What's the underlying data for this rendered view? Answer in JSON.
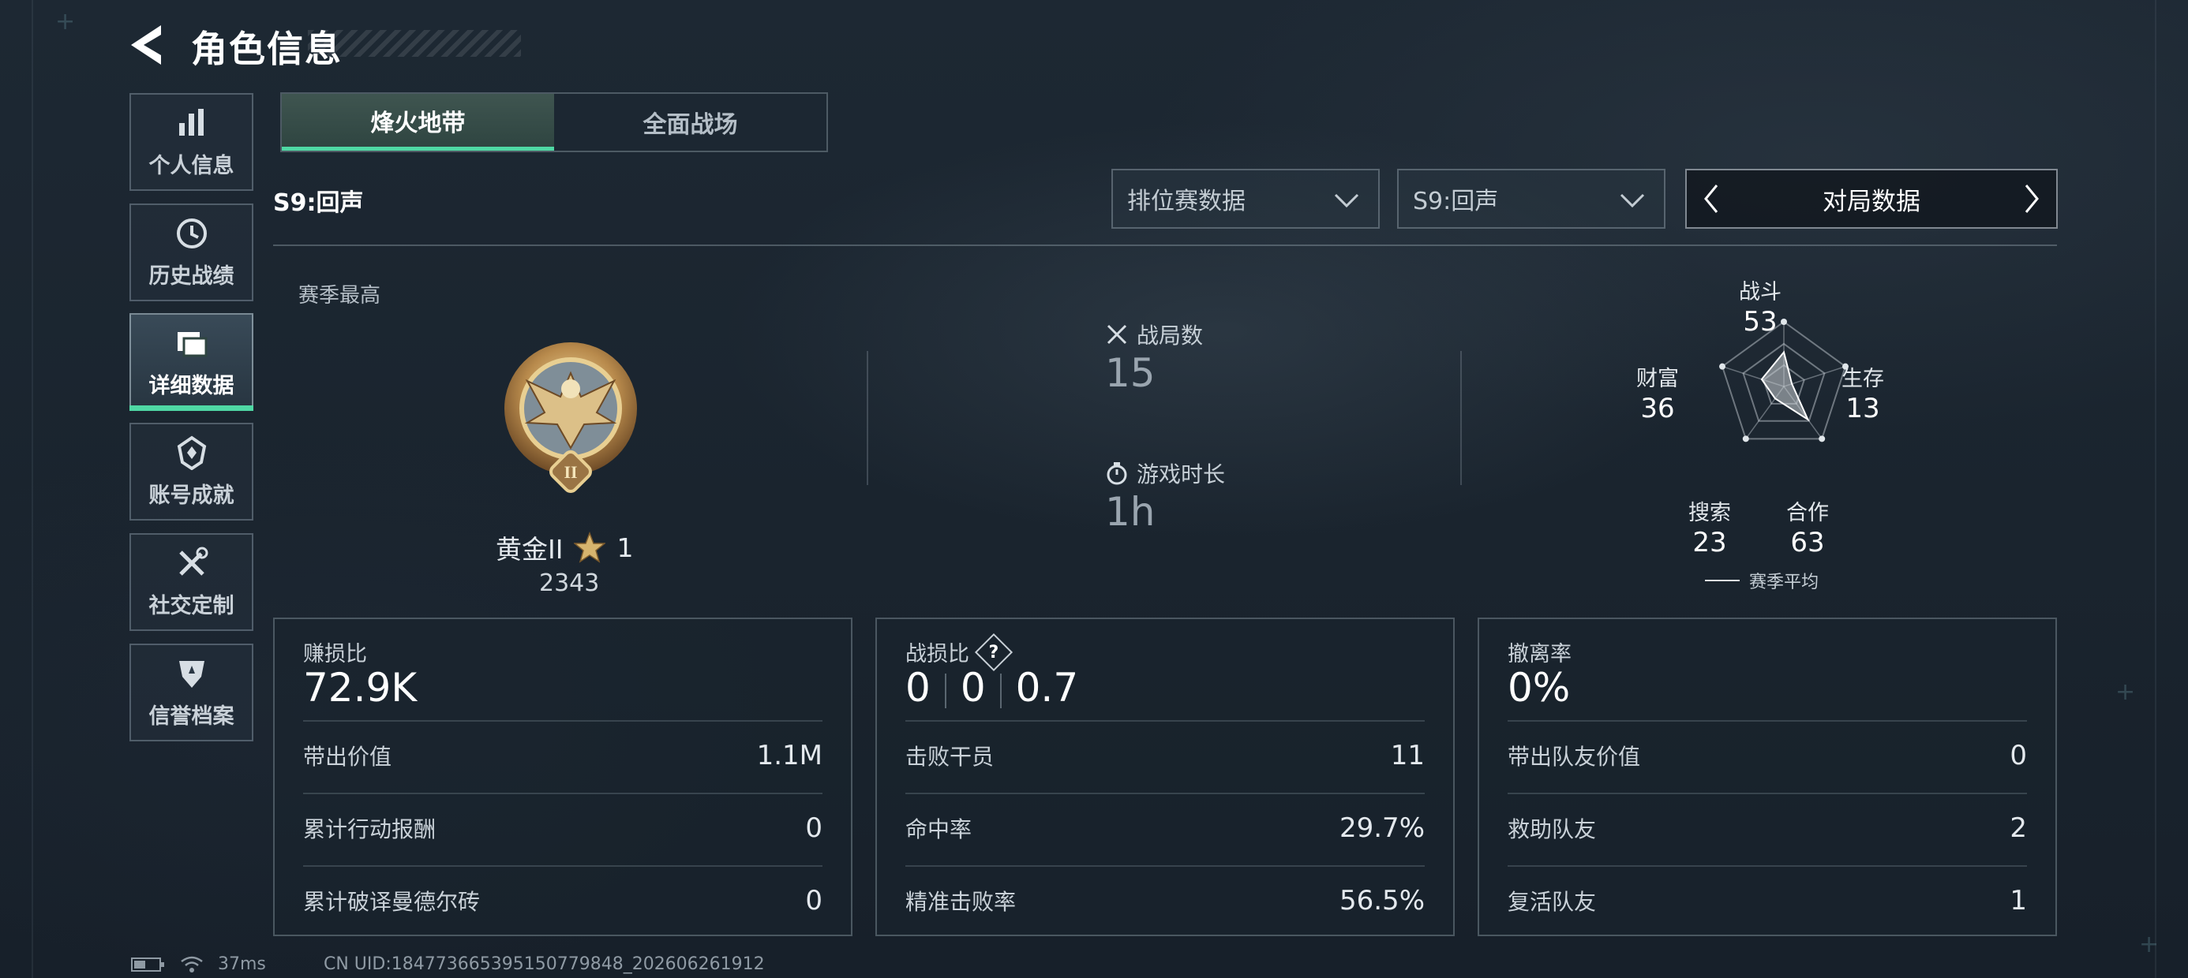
{
  "header": {
    "title": "角色信息"
  },
  "sidebar": {
    "items": [
      {
        "label": "个人信息",
        "icon": "bar-chart-icon"
      },
      {
        "label": "历史战绩",
        "icon": "clock-icon"
      },
      {
        "label": "详细数据",
        "icon": "folder-icon",
        "active": true
      },
      {
        "label": "账号成就",
        "icon": "achievement-icon"
      },
      {
        "label": "社交定制",
        "icon": "tools-icon"
      },
      {
        "label": "信誉档案",
        "icon": "shield-icon"
      }
    ]
  },
  "mode_tabs": [
    {
      "label": "烽火地带",
      "active": true
    },
    {
      "label": "全面战场",
      "active": false
    }
  ],
  "season_label": "S9:回声",
  "filters": {
    "data_type": "排位赛数据",
    "season": "S9:回声",
    "view": "对局数据"
  },
  "rank": {
    "section_label": "赛季最高",
    "tier": "黄金II",
    "stars": "1",
    "score": "2343"
  },
  "overview": {
    "matches_label": "战局数",
    "matches_value": "15",
    "playtime_label": "游戏时长",
    "playtime_value": "1h"
  },
  "radar": {
    "axes": [
      {
        "label": "战斗",
        "value": "53"
      },
      {
        "label": "生存",
        "value": "13"
      },
      {
        "label": "合作",
        "value": "63"
      },
      {
        "label": "搜索",
        "value": "23"
      },
      {
        "label": "财富",
        "value": "36"
      }
    ],
    "max": 100,
    "legend": "赛季平均"
  },
  "panels": {
    "profit": {
      "title": "赚损比",
      "value": "72.9K",
      "rows": [
        {
          "label": "带出价值",
          "value": "1.1M"
        },
        {
          "label": "累计行动报酬",
          "value": "0"
        },
        {
          "label": "累计破译曼德尔砖",
          "value": "0"
        }
      ]
    },
    "combat": {
      "title": "战损比",
      "help_icon": "?",
      "values": [
        "0",
        "0",
        "0.7"
      ],
      "rows": [
        {
          "label": "击败干员",
          "value": "11"
        },
        {
          "label": "命中率",
          "value": "29.7%"
        },
        {
          "label": "精准击败率",
          "value": "56.5%"
        }
      ]
    },
    "extraction": {
      "title": "撤离率",
      "value": "0%",
      "rows": [
        {
          "label": "带出队友价值",
          "value": "0"
        },
        {
          "label": "救助队友",
          "value": "2"
        },
        {
          "label": "复活队友",
          "value": "1"
        }
      ]
    }
  },
  "status_bar": {
    "ping": "37ms",
    "uid": "CN UID:184773665395150779848_202606261912"
  },
  "colors": {
    "accent": "#4fd8a4",
    "background": "#1b2530"
  }
}
